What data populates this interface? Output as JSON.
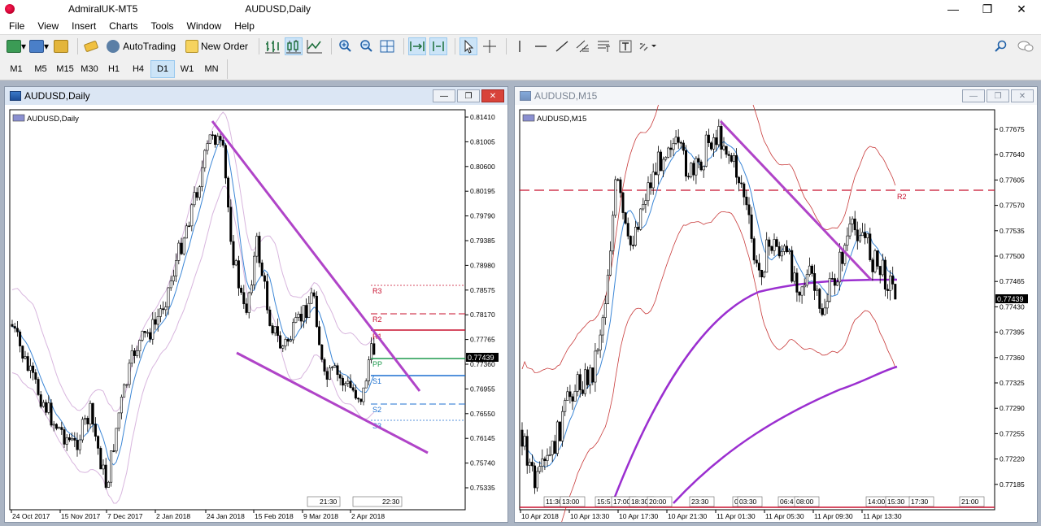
{
  "app": {
    "title": "AdmiralUK-MT5",
    "chart_title": "AUDUSD,Daily"
  },
  "window_controls": {
    "minimize": "—",
    "maximize": "❐",
    "close": "✕"
  },
  "menu": [
    "File",
    "View",
    "Insert",
    "Charts",
    "Tools",
    "Window",
    "Help"
  ],
  "toolbar": {
    "autotrading_label": "AutoTrading",
    "new_order_label": "New Order"
  },
  "timeframes": [
    "M1",
    "M5",
    "M15",
    "M30",
    "H1",
    "H4",
    "D1",
    "W1",
    "MN"
  ],
  "active_timeframe": "D1",
  "left_window": {
    "caption": "AUDUSD,Daily",
    "symbol_label": "AUDUSD,Daily",
    "current_price": "0.77439",
    "price_ticks": [
      "0.81410",
      "0.81005",
      "0.80600",
      "0.80195",
      "0.79790",
      "0.79385",
      "0.78980",
      "0.78575",
      "0.78170",
      "0.77765",
      "0.77360",
      "0.76955",
      "0.76550",
      "0.76145",
      "0.75740",
      "0.75335"
    ],
    "date_ticks": [
      "24 Oct 2017",
      "15 Nov 2017",
      "7 Dec 2017",
      "2 Jan 2018",
      "24 Jan 2018",
      "15 Feb 2018",
      "9 Mar 2018",
      "2 Apr 2018"
    ],
    "pivot_labels": {
      "r3": "R3",
      "r2": "R2",
      "r1": "R1",
      "pp": "PP",
      "s1": "S1",
      "s2": "S2",
      "s3": "S3"
    },
    "session_marks": [
      "21:30",
      "22:30"
    ]
  },
  "right_window": {
    "caption": "AUDUSD,M15",
    "symbol_label": "AUDUSD,M15",
    "current_price": "0.77439",
    "price_ticks": [
      "0.77675",
      "0.77640",
      "0.77605",
      "0.77570",
      "0.77535",
      "0.77500",
      "0.77465",
      "0.77430",
      "0.77395",
      "0.77360",
      "0.77325",
      "0.77290",
      "0.77255",
      "0.77220",
      "0.77185"
    ],
    "date_ticks": [
      "10 Apr 2018",
      "10 Apr 13:30",
      "10 Apr 17:30",
      "10 Apr 21:30",
      "11 Apr 01:30",
      "11 Apr 05:30",
      "11 Apr 09:30",
      "11 Apr 13:30"
    ],
    "r2_label": "R2",
    "session_marks": [
      "11:30",
      "13:00",
      "15:5",
      "17:00",
      "18:30",
      "20:00",
      "23:30",
      "0",
      "03:30",
      "06:4",
      "08:00",
      "14:00",
      "15:30",
      "17:30",
      "21:00"
    ]
  },
  "colors": {
    "trendline": "#b044c8",
    "pivot_red": "#c8102e",
    "pivot_green": "#1e9a4e",
    "pivot_blue": "#1c6fd0",
    "ma_blue": "#3b86d6",
    "band_pink": "#d8b6de",
    "band_red": "#c83a3a",
    "ma_purple": "#9b2fd0"
  }
}
